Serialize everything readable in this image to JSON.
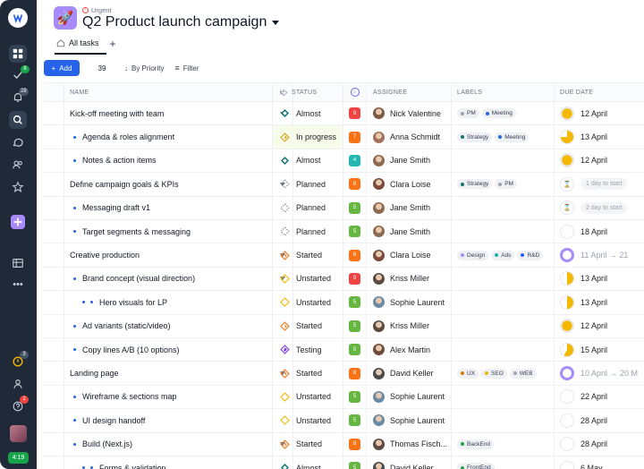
{
  "sidebar": {
    "badges": {
      "check": "8",
      "bell": "28",
      "timer": "3",
      "help": "1"
    },
    "time": "4:19",
    "icons": [
      "logo-icon",
      "grid-icon",
      "check-icon",
      "bell-icon",
      "search-icon",
      "chat-icon",
      "people-icon",
      "star-icon",
      "plus-icon",
      "table-icon",
      "more-icon",
      "timer-icon",
      "user-icon",
      "help-icon",
      "avatar"
    ]
  },
  "header": {
    "urgent": "Urgent",
    "title": "Q2 Product launch campaign",
    "tab_all": "All tasks",
    "tab_add": "+"
  },
  "toolbar": {
    "add_label": "Add",
    "count": "39",
    "sort_label": "By Priority",
    "filter_label": "Filter"
  },
  "columns": {
    "name": "NAME",
    "status": "STATUS",
    "assignee": "ASSIGNEE",
    "labels": "LABELS",
    "due": "DUE DATE"
  },
  "rows": [
    {
      "name": "Kick-off meeting with team",
      "sub": 0,
      "caret": true,
      "status": "Almost",
      "icon": "almost",
      "prio": "9",
      "pcolor": "#ef4444",
      "assignee": "Nick Valentine",
      "av": "#7c5a46",
      "labels": [
        {
          "t": "PM",
          "c": "#9ca3af"
        },
        {
          "t": "Meeting",
          "c": "#2563eb"
        }
      ],
      "due": "12 April",
      "dstyle": "full",
      "dcolor": "#f5b800"
    },
    {
      "name": "Agenda & roles alignment",
      "sub": 1,
      "status": "In progress",
      "icon": "progress",
      "prio": "7",
      "pcolor": "#f97316",
      "assignee": "Anna Schmidt",
      "av": "#a0705a",
      "labels": [
        {
          "t": "Strategy",
          "c": "#0f766e"
        },
        {
          "t": "Meeting",
          "c": "#2563eb"
        }
      ],
      "due": "13 April",
      "dstyle": "three",
      "dcolor": "#f5b800",
      "hl": true
    },
    {
      "name": "Notes & action items",
      "sub": 1,
      "status": "Almost",
      "icon": "almost",
      "prio": "4",
      "pcolor": "#22b8b0",
      "assignee": "Jane Smith",
      "av": "#8b6a52",
      "labels": [],
      "due": "12 April",
      "dstyle": "full",
      "dcolor": "#f5b800"
    },
    {
      "name": "Define campaign goals & KPIs",
      "sub": 0,
      "caret": true,
      "status": "Planned",
      "icon": "planned",
      "prio": "8",
      "pcolor": "#f97316",
      "assignee": "Clara Loise",
      "av": "#7a4b3a",
      "labels": [
        {
          "t": "Strategy",
          "c": "#0f766e"
        },
        {
          "t": "PM",
          "c": "#9ca3af"
        }
      ],
      "due": "1 day to start",
      "dstyle": "pill"
    },
    {
      "name": "Messaging draft v1",
      "sub": 1,
      "status": "Planned",
      "icon": "planned",
      "prio": "5",
      "pcolor": "#65b741",
      "assignee": "Jane Smith",
      "av": "#8b6a52",
      "labels": [],
      "due": "2 day to start",
      "dstyle": "pill"
    },
    {
      "name": "Target segments & messaging",
      "sub": 1,
      "status": "Planned",
      "icon": "planned",
      "prio": "5",
      "pcolor": "#65b741",
      "assignee": "Jane Smith",
      "av": "#8b6a52",
      "labels": [],
      "due": "18 April",
      "dstyle": "empty"
    },
    {
      "name": "Creative production",
      "sub": 0,
      "caret": true,
      "status": "Started",
      "icon": "started",
      "prio": "8",
      "pcolor": "#f97316",
      "assignee": "Clara Loise",
      "av": "#7a4b3a",
      "labels": [
        {
          "t": "Design",
          "c": "#a78bfa"
        },
        {
          "t": "Ads",
          "c": "#14b8a6"
        },
        {
          "t": "R&D",
          "c": "#2563eb"
        }
      ],
      "due": "11 April → 21",
      "dstyle": "ring",
      "dcolor": "#a78bfa",
      "muted": true
    },
    {
      "name": "Brand concept (visual direction)",
      "sub": 1,
      "caret": true,
      "status": "Unstarted",
      "icon": "unstarted",
      "prio": "9",
      "pcolor": "#ef4444",
      "assignee": "Kriss Miller",
      "av": "#5a4a42",
      "labels": [],
      "due": "13 April",
      "dstyle": "half",
      "dcolor": "#f5b800"
    },
    {
      "name": "Hero visuals for LP",
      "sub": 2,
      "status": "Unstarted",
      "icon": "unstarted",
      "prio": "5",
      "pcolor": "#65b741",
      "assignee": "Sophie Laurent",
      "av": "#6b8aa3",
      "labels": [],
      "due": "13 April",
      "dstyle": "half",
      "dcolor": "#f5b800"
    },
    {
      "name": "Ad variants (static/video)",
      "sub": 1,
      "status": "Started",
      "icon": "started",
      "prio": "5",
      "pcolor": "#65b741",
      "assignee": "Kriss Miller",
      "av": "#5a4a42",
      "labels": [],
      "due": "12 April",
      "dstyle": "full",
      "dcolor": "#f5b800"
    },
    {
      "name": "Copy lines A/B (10 options)",
      "sub": 1,
      "status": "Testing",
      "icon": "testing",
      "prio": "5",
      "pcolor": "#65b741",
      "assignee": "Alex Martin",
      "av": "#6d4c3d",
      "labels": [],
      "due": "15 April",
      "dstyle": "quarter",
      "dcolor": "#f5b800"
    },
    {
      "name": "Landing page",
      "sub": 0,
      "caret": true,
      "status": "Started",
      "icon": "started",
      "prio": "8",
      "pcolor": "#f97316",
      "assignee": "David Keller",
      "av": "#4a4a4a",
      "labels": [
        {
          "t": "UX",
          "c": "#d97706"
        },
        {
          "t": "SEO",
          "c": "#eab308"
        },
        {
          "t": "WEB",
          "c": "#9ca3af"
        }
      ],
      "due": "10 April → 20 M",
      "dstyle": "ring",
      "dcolor": "#a78bfa",
      "muted": true
    },
    {
      "name": "Wireframe & sections map",
      "sub": 1,
      "status": "Unstarted",
      "icon": "unstarted",
      "prio": "5",
      "pcolor": "#65b741",
      "assignee": "Sophie Laurent",
      "av": "#6b8aa3",
      "labels": [],
      "due": "22 April",
      "dstyle": "empty"
    },
    {
      "name": "UI design handoff",
      "sub": 1,
      "status": "Unstarted",
      "icon": "unstarted",
      "prio": "5",
      "pcolor": "#65b741",
      "assignee": "Sophie Laurent",
      "av": "#6b8aa3",
      "labels": [],
      "due": "28 April",
      "dstyle": "empty"
    },
    {
      "name": "Build (Next.js)",
      "sub": 1,
      "caret": true,
      "status": "Started",
      "icon": "started",
      "prio": "8",
      "pcolor": "#f97316",
      "assignee": "Thomas Fisch...",
      "av": "#5a4a42",
      "labels": [
        {
          "t": "BackEnd",
          "c": "#16a34a"
        }
      ],
      "due": "28 April",
      "dstyle": "empty"
    },
    {
      "name": "Forms & validation",
      "sub": 2,
      "status": "Almost",
      "icon": "almost",
      "prio": "5",
      "pcolor": "#65b741",
      "assignee": "David Keller",
      "av": "#4a4a4a",
      "labels": [
        {
          "t": "FrontEnd",
          "c": "#16a34a"
        }
      ],
      "due": "6 May",
      "dstyle": "empty"
    }
  ]
}
